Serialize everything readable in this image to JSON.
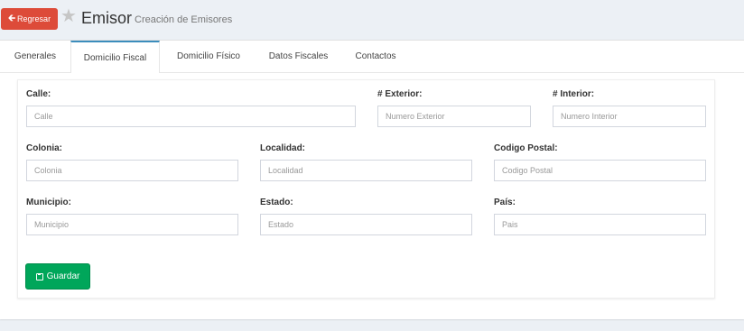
{
  "header": {
    "back_label": "Regresar",
    "back_icon": "arrow-left-icon",
    "star_icon": "star-icon",
    "title": "Emisor",
    "subtitle": "Creación de Emisores"
  },
  "tabs": [
    {
      "label": "Generales",
      "active": false
    },
    {
      "label": "Domicilio Fiscal",
      "active": true
    },
    {
      "label": "Domicilio Físico",
      "active": false
    },
    {
      "label": "Datos Fiscales",
      "active": false
    },
    {
      "label": "Contactos",
      "active": false
    }
  ],
  "form": {
    "calle": {
      "label": "Calle:",
      "placeholder": "Calle",
      "value": ""
    },
    "exterior": {
      "label": "# Exterior:",
      "placeholder": "Numero Exterior",
      "value": ""
    },
    "interior": {
      "label": "# Interior:",
      "placeholder": "Numero Interior",
      "value": ""
    },
    "colonia": {
      "label": "Colonia:",
      "placeholder": "Colonia",
      "value": ""
    },
    "localidad": {
      "label": "Localidad:",
      "placeholder": "Localidad",
      "value": ""
    },
    "codigo_postal": {
      "label": "Codigo Postal:",
      "placeholder": "Codigo Postal",
      "value": ""
    },
    "municipio": {
      "label": "Municipio:",
      "placeholder": "Municipio",
      "value": ""
    },
    "estado": {
      "label": "Estado:",
      "placeholder": "Estado",
      "value": ""
    },
    "pais": {
      "label": "País:",
      "placeholder": "Pais",
      "value": ""
    }
  },
  "save_button": {
    "label": "Guardar",
    "icon": "save-icon"
  },
  "colors": {
    "back_button": "#dd4b39",
    "save_button": "#00a65a",
    "active_tab_accent": "#3c8dbc",
    "page_background": "#ecf0f5"
  }
}
